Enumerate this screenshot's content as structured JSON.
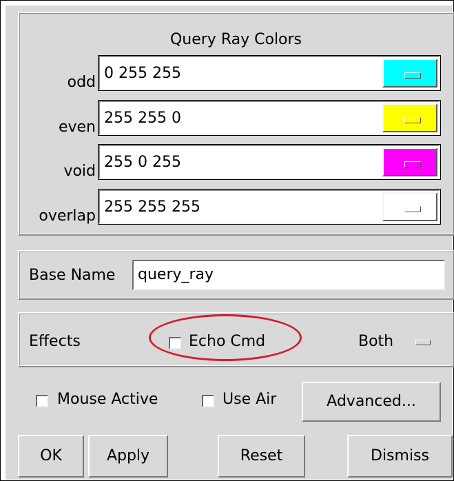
{
  "colors_group": {
    "title": "Query Ray Colors",
    "rows": [
      {
        "label": "odd",
        "value": "0 255 255",
        "swatch": "#00ffff"
      },
      {
        "label": "even",
        "value": "255 255 0",
        "swatch": "#ffff00"
      },
      {
        "label": "void",
        "value": "255 0 255",
        "swatch": "#ff00ff"
      },
      {
        "label": "overlap",
        "value": "255 255 255",
        "swatch": "#ffffff"
      }
    ]
  },
  "base": {
    "label": "Base Name",
    "value": "query_ray"
  },
  "effects": {
    "label": "Effects",
    "echo_label": "Echo Cmd",
    "menu_value": "Both"
  },
  "options": {
    "mouse_label": "Mouse Active",
    "air_label": "Use Air",
    "advanced_label": "Advanced..."
  },
  "buttons": {
    "ok": "OK",
    "apply": "Apply",
    "reset": "Reset",
    "dismiss": "Dismiss"
  },
  "annotation_color": "#d21f2a"
}
